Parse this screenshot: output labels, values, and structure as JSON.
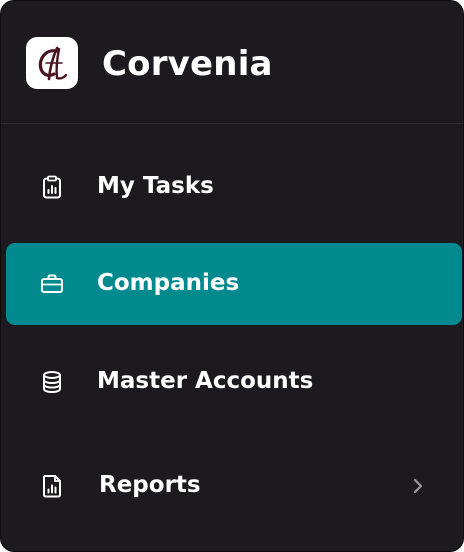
{
  "app": {
    "name": "Corvenia",
    "logo_icon": "corvenia-monogram-logo"
  },
  "nav": {
    "items": [
      {
        "label": "My Tasks",
        "icon": "clipboard-chart-icon",
        "active": false
      },
      {
        "label": "Companies",
        "icon": "briefcase-icon",
        "active": true
      },
      {
        "label": "Master Accounts",
        "icon": "database-icon",
        "active": false
      },
      {
        "label": "Reports",
        "icon": "report-chart-icon",
        "active": false,
        "has_submenu": true,
        "submenu_icon": "chevron-right-icon"
      }
    ]
  },
  "colors": {
    "sidebar_bg": "#1c191f",
    "active_bg": "#008a8e",
    "text": "#ffffff",
    "divider": "#2e2b32",
    "logo_mark": "#4a1420",
    "icon_muted": "#9a98a0"
  }
}
